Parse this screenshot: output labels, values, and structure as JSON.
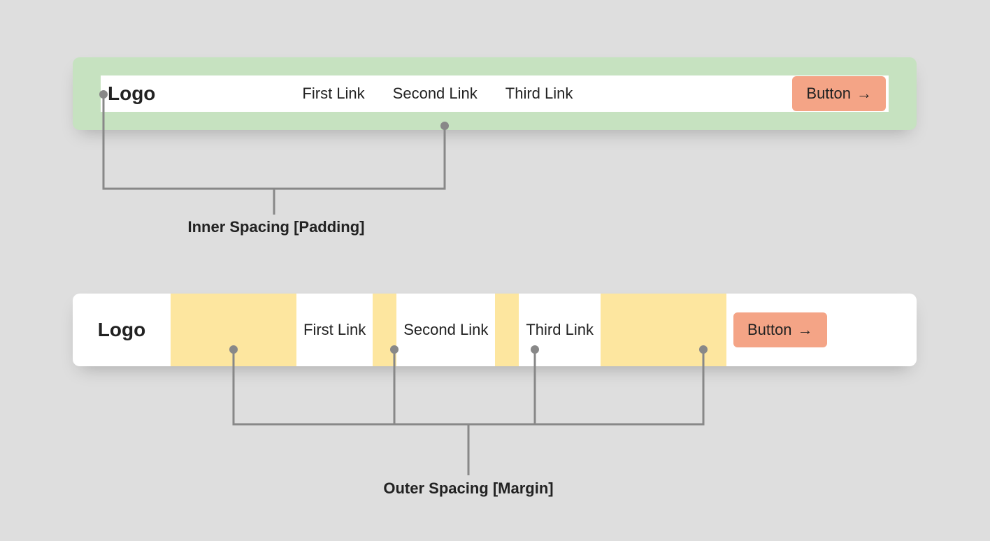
{
  "example1": {
    "logo": "Logo",
    "links": [
      "First Link",
      "Second Link",
      "Third Link"
    ],
    "button": "Button",
    "caption": "Inner Spacing [Padding]"
  },
  "example2": {
    "logo": "Logo",
    "links": [
      "First Link",
      "Second Link",
      "Third Link"
    ],
    "button": "Button",
    "caption": "Outer Spacing [Margin]"
  },
  "colors": {
    "padding_bg": "#c6e2c0",
    "margin_bg": "#fde69f",
    "button_bg": "#f4a486",
    "page_bg": "#dedede"
  }
}
